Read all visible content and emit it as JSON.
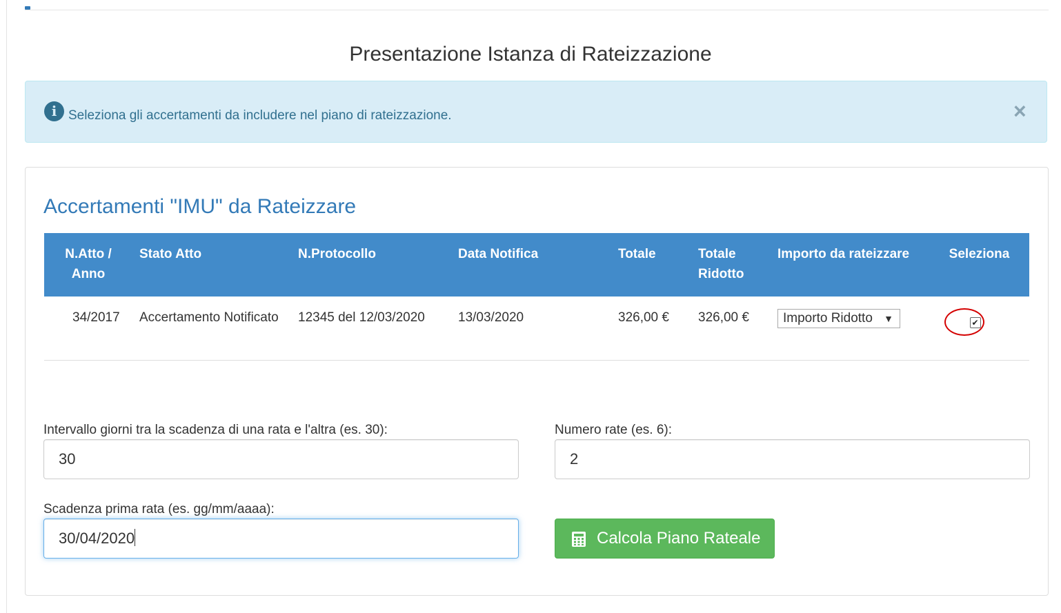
{
  "page": {
    "title": "Presentazione Istanza di Rateizzazione"
  },
  "alert": {
    "icon": "info-icon",
    "message": "Seleziona gli accertamenti da includere nel piano di rateizzazione.",
    "close_label": "×"
  },
  "panel": {
    "title": "Accertamenti \"IMU\" da Rateizzare",
    "table": {
      "columns": [
        "N.Atto / Anno",
        "Stato Atto",
        "N.Protocollo",
        "Data Notifica",
        "Totale",
        "Totale Ridotto",
        "Importo da rateizzare",
        "Seleziona"
      ],
      "rows": [
        {
          "atto_anno": "34/2017",
          "stato": "Accertamento Notificato",
          "protocollo": "12345 del 12/03/2020",
          "data_notifica": "13/03/2020",
          "totale": "326,00 €",
          "totale_ridotto": "326,00 €",
          "importo_select": "Importo Ridotto",
          "selected": true
        }
      ]
    }
  },
  "form": {
    "intervallo": {
      "label": "Intervallo giorni tra la scadenza di una rata e l'altra (es. 30):",
      "value": "30"
    },
    "numero_rate": {
      "label": "Numero rate (es. 6):",
      "value": "2"
    },
    "scadenza": {
      "label": "Scadenza prima rata (es. gg/mm/aaaa):",
      "value": "30/04/2020"
    },
    "calc_button": {
      "label": "Calcola Piano Rateale",
      "icon": "calculator-icon"
    }
  },
  "colors": {
    "table_header": "#428bca",
    "panel_title": "#337ab7",
    "alert_bg": "#d9edf7",
    "alert_text": "#31708f",
    "button_green": "#5cb85c",
    "highlight_red": "#d40000"
  }
}
